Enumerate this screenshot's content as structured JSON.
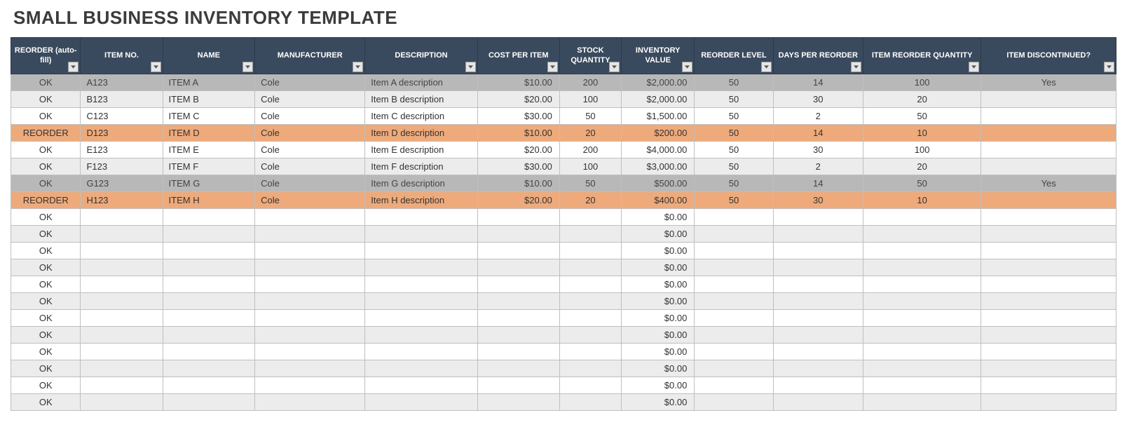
{
  "title": "SMALL BUSINESS INVENTORY TEMPLATE",
  "columns": [
    "REORDER (auto-fill)",
    "ITEM NO.",
    "NAME",
    "MANUFACTURER",
    "DESCRIPTION",
    "COST PER ITEM",
    "STOCK QUANTITY",
    "INVENTORY VALUE",
    "REORDER LEVEL",
    "DAYS PER REORDER",
    "ITEM REORDER QUANTITY",
    "ITEM DISCONTINUED?"
  ],
  "rows": [
    {
      "status": "grey",
      "reorder": "OK",
      "item_no": "A123",
      "name": "ITEM A",
      "mfg": "Cole",
      "desc": "Item A description",
      "cost": "$10.00",
      "stock": "200",
      "inv_value": "$2,000.00",
      "rl": "50",
      "dpr": "14",
      "irq": "100",
      "disc": "Yes"
    },
    {
      "status": "even",
      "reorder": "OK",
      "item_no": "B123",
      "name": "ITEM B",
      "mfg": "Cole",
      "desc": "Item B description",
      "cost": "$20.00",
      "stock": "100",
      "inv_value": "$2,000.00",
      "rl": "50",
      "dpr": "30",
      "irq": "20",
      "disc": ""
    },
    {
      "status": "odd",
      "reorder": "OK",
      "item_no": "C123",
      "name": "ITEM C",
      "mfg": "Cole",
      "desc": "Item C description",
      "cost": "$30.00",
      "stock": "50",
      "inv_value": "$1,500.00",
      "rl": "50",
      "dpr": "2",
      "irq": "50",
      "disc": ""
    },
    {
      "status": "orange",
      "reorder": "REORDER",
      "item_no": "D123",
      "name": "ITEM D",
      "mfg": "Cole",
      "desc": "Item D description",
      "cost": "$10.00",
      "stock": "20",
      "inv_value": "$200.00",
      "rl": "50",
      "dpr": "14",
      "irq": "10",
      "disc": ""
    },
    {
      "status": "odd",
      "reorder": "OK",
      "item_no": "E123",
      "name": "ITEM E",
      "mfg": "Cole",
      "desc": "Item E description",
      "cost": "$20.00",
      "stock": "200",
      "inv_value": "$4,000.00",
      "rl": "50",
      "dpr": "30",
      "irq": "100",
      "disc": ""
    },
    {
      "status": "even",
      "reorder": "OK",
      "item_no": "F123",
      "name": "ITEM F",
      "mfg": "Cole",
      "desc": "Item F description",
      "cost": "$30.00",
      "stock": "100",
      "inv_value": "$3,000.00",
      "rl": "50",
      "dpr": "2",
      "irq": "20",
      "disc": ""
    },
    {
      "status": "grey",
      "reorder": "OK",
      "item_no": "G123",
      "name": "ITEM G",
      "mfg": "Cole",
      "desc": "Item G description",
      "cost": "$10.00",
      "stock": "50",
      "inv_value": "$500.00",
      "rl": "50",
      "dpr": "14",
      "irq": "50",
      "disc": "Yes"
    },
    {
      "status": "orange",
      "reorder": "REORDER",
      "item_no": "H123",
      "name": "ITEM H",
      "mfg": "Cole",
      "desc": "Item H description",
      "cost": "$20.00",
      "stock": "20",
      "inv_value": "$400.00",
      "rl": "50",
      "dpr": "30",
      "irq": "10",
      "disc": ""
    },
    {
      "status": "odd",
      "reorder": "OK",
      "item_no": "",
      "name": "",
      "mfg": "",
      "desc": "",
      "cost": "",
      "stock": "",
      "inv_value": "$0.00",
      "rl": "",
      "dpr": "",
      "irq": "",
      "disc": ""
    },
    {
      "status": "even",
      "reorder": "OK",
      "item_no": "",
      "name": "",
      "mfg": "",
      "desc": "",
      "cost": "",
      "stock": "",
      "inv_value": "$0.00",
      "rl": "",
      "dpr": "",
      "irq": "",
      "disc": ""
    },
    {
      "status": "odd",
      "reorder": "OK",
      "item_no": "",
      "name": "",
      "mfg": "",
      "desc": "",
      "cost": "",
      "stock": "",
      "inv_value": "$0.00",
      "rl": "",
      "dpr": "",
      "irq": "",
      "disc": ""
    },
    {
      "status": "even",
      "reorder": "OK",
      "item_no": "",
      "name": "",
      "mfg": "",
      "desc": "",
      "cost": "",
      "stock": "",
      "inv_value": "$0.00",
      "rl": "",
      "dpr": "",
      "irq": "",
      "disc": ""
    },
    {
      "status": "odd",
      "reorder": "OK",
      "item_no": "",
      "name": "",
      "mfg": "",
      "desc": "",
      "cost": "",
      "stock": "",
      "inv_value": "$0.00",
      "rl": "",
      "dpr": "",
      "irq": "",
      "disc": ""
    },
    {
      "status": "even",
      "reorder": "OK",
      "item_no": "",
      "name": "",
      "mfg": "",
      "desc": "",
      "cost": "",
      "stock": "",
      "inv_value": "$0.00",
      "rl": "",
      "dpr": "",
      "irq": "",
      "disc": ""
    },
    {
      "status": "odd",
      "reorder": "OK",
      "item_no": "",
      "name": "",
      "mfg": "",
      "desc": "",
      "cost": "",
      "stock": "",
      "inv_value": "$0.00",
      "rl": "",
      "dpr": "",
      "irq": "",
      "disc": ""
    },
    {
      "status": "even",
      "reorder": "OK",
      "item_no": "",
      "name": "",
      "mfg": "",
      "desc": "",
      "cost": "",
      "stock": "",
      "inv_value": "$0.00",
      "rl": "",
      "dpr": "",
      "irq": "",
      "disc": ""
    },
    {
      "status": "odd",
      "reorder": "OK",
      "item_no": "",
      "name": "",
      "mfg": "",
      "desc": "",
      "cost": "",
      "stock": "",
      "inv_value": "$0.00",
      "rl": "",
      "dpr": "",
      "irq": "",
      "disc": ""
    },
    {
      "status": "even",
      "reorder": "OK",
      "item_no": "",
      "name": "",
      "mfg": "",
      "desc": "",
      "cost": "",
      "stock": "",
      "inv_value": "$0.00",
      "rl": "",
      "dpr": "",
      "irq": "",
      "disc": ""
    },
    {
      "status": "odd",
      "reorder": "OK",
      "item_no": "",
      "name": "",
      "mfg": "",
      "desc": "",
      "cost": "",
      "stock": "",
      "inv_value": "$0.00",
      "rl": "",
      "dpr": "",
      "irq": "",
      "disc": ""
    },
    {
      "status": "even",
      "reorder": "OK",
      "item_no": "",
      "name": "",
      "mfg": "",
      "desc": "",
      "cost": "",
      "stock": "",
      "inv_value": "$0.00",
      "rl": "",
      "dpr": "",
      "irq": "",
      "disc": ""
    }
  ]
}
